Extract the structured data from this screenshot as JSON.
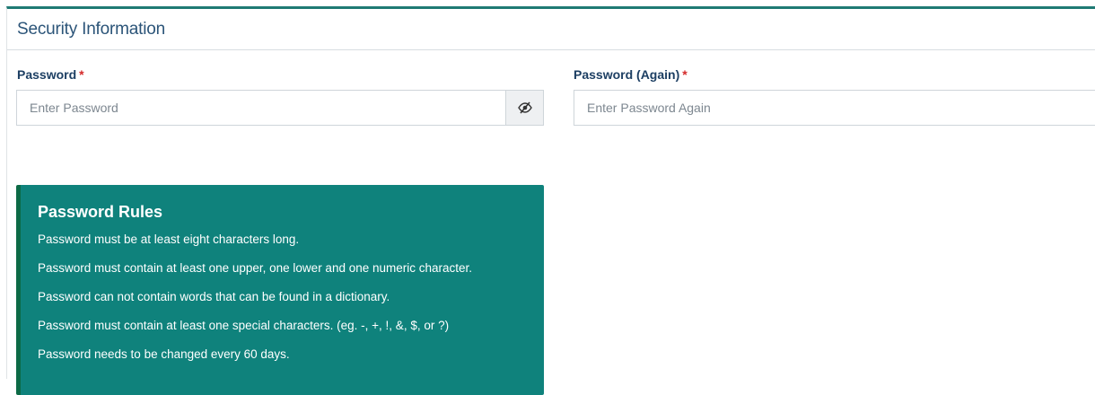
{
  "section": {
    "title": "Security Information"
  },
  "password": {
    "label": "Password",
    "required_mark": "*",
    "placeholder": "Enter Password",
    "toggle_icon": "eye-slash-icon"
  },
  "password_again": {
    "label": "Password (Again)",
    "required_mark": "*",
    "placeholder": "Enter Password Again"
  },
  "rules": {
    "title": "Password Rules",
    "items": [
      "Password must be at least eight characters long.",
      "Password must contain at least one upper, one lower and one numeric character.",
      "Password can not contain words that can be found in a dictionary.",
      "Password must contain at least one special characters. (eg. -, +, !, &, $, or ?)",
      "Password needs to be changed every 60 days."
    ]
  },
  "colors": {
    "header_accent": "#1f7a74",
    "label_text": "#1d3f63",
    "required": "#d42a2a",
    "rules_bg": "#0f827c",
    "rules_border": "#0c6a46"
  }
}
